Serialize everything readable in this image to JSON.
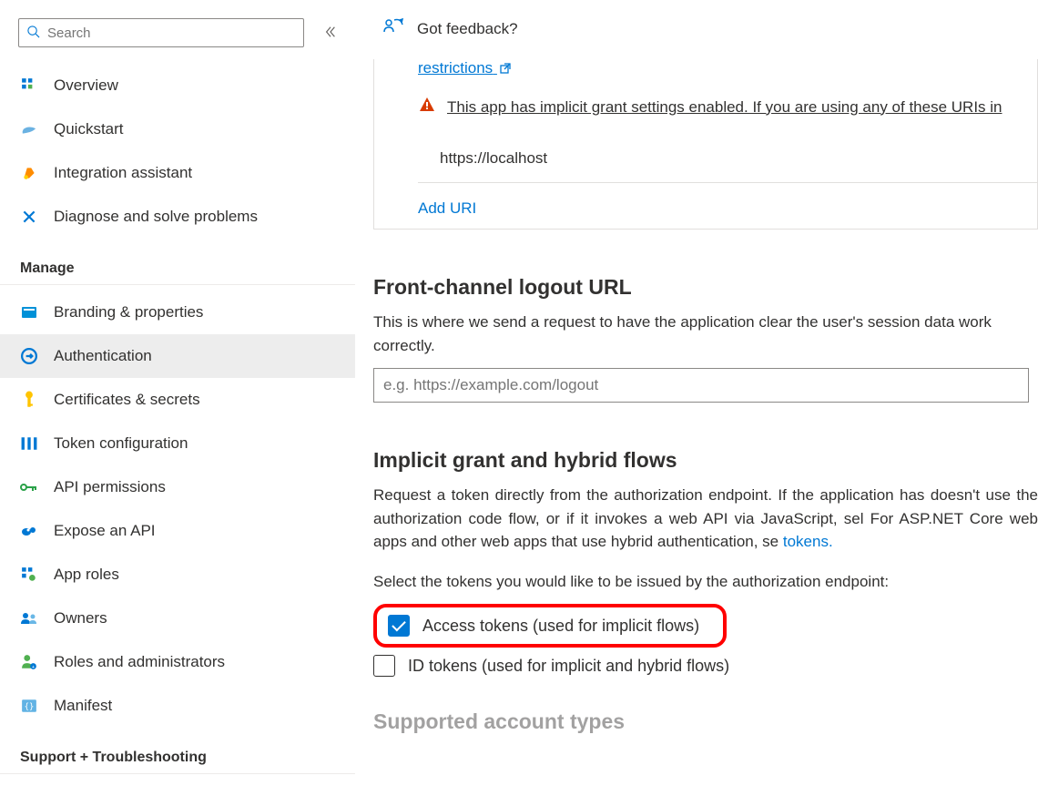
{
  "sidebar": {
    "searchPlaceholder": "Search",
    "items": [
      {
        "label": "Overview"
      },
      {
        "label": "Quickstart"
      },
      {
        "label": "Integration assistant"
      },
      {
        "label": "Diagnose and solve problems"
      }
    ],
    "manageHeader": "Manage",
    "manageItems": [
      {
        "label": "Branding & properties"
      },
      {
        "label": "Authentication"
      },
      {
        "label": "Certificates & secrets"
      },
      {
        "label": "Token configuration"
      },
      {
        "label": "API permissions"
      },
      {
        "label": "Expose an API"
      },
      {
        "label": "App roles"
      },
      {
        "label": "Owners"
      },
      {
        "label": "Roles and administrators"
      },
      {
        "label": "Manifest"
      }
    ],
    "supportHeader": "Support + Troubleshooting"
  },
  "main": {
    "feedback": "Got feedback?",
    "restrictionsLink": "restrictions",
    "warning": "This app has implicit grant settings enabled. If you are using any of these URIs in",
    "uri": "https://localhost",
    "addUri": "Add URI",
    "frontChannel": {
      "title": "Front-channel logout URL",
      "desc": "This is where we send a request to have the application clear the user's session data work correctly.",
      "placeholder": "e.g. https://example.com/logout"
    },
    "implicit": {
      "title": "Implicit grant and hybrid flows",
      "desc1": "Request a token directly from the authorization endpoint. If the application has doesn't use the authorization code flow, or if it invokes a web API via JavaScript, sel For ASP.NET Core web apps and other web apps that use hybrid authentication, se",
      "tokensLink": "tokens.",
      "selectText": "Select the tokens you would like to be issued by the authorization endpoint:",
      "accessTokens": "Access tokens (used for implicit flows)",
      "idTokens": "ID tokens (used for implicit and hybrid flows)"
    },
    "supportedHeading": "Supported account types"
  }
}
